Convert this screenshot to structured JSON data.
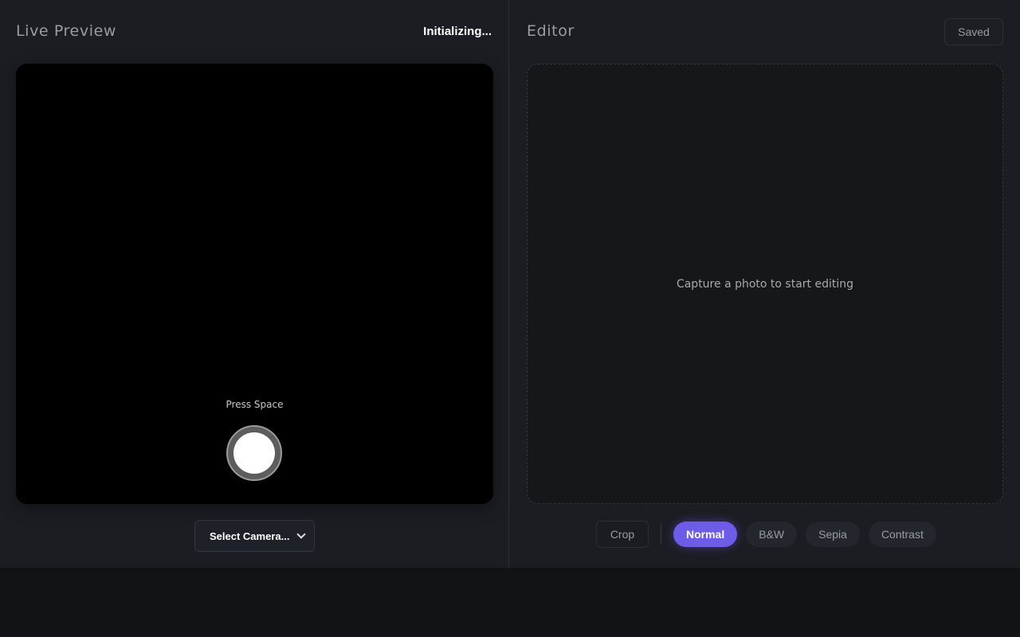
{
  "live_preview": {
    "title": "Live Preview",
    "status": "Initializing...",
    "hint": "Press Space",
    "camera_select": {
      "selected": "Select Camera..."
    }
  },
  "editor": {
    "title": "Editor",
    "save_status": "Saved",
    "empty_message": "Capture a photo to start editing",
    "toolbar": {
      "crop_label": "Crop",
      "filters": [
        {
          "label": "Normal",
          "active": true
        },
        {
          "label": "B&W",
          "active": false
        },
        {
          "label": "Sepia",
          "active": false
        },
        {
          "label": "Contrast",
          "active": false
        }
      ]
    }
  },
  "colors": {
    "accent": "#6c5ce7",
    "panel_bg": "#1b1d23",
    "page_bg": "#121317"
  }
}
